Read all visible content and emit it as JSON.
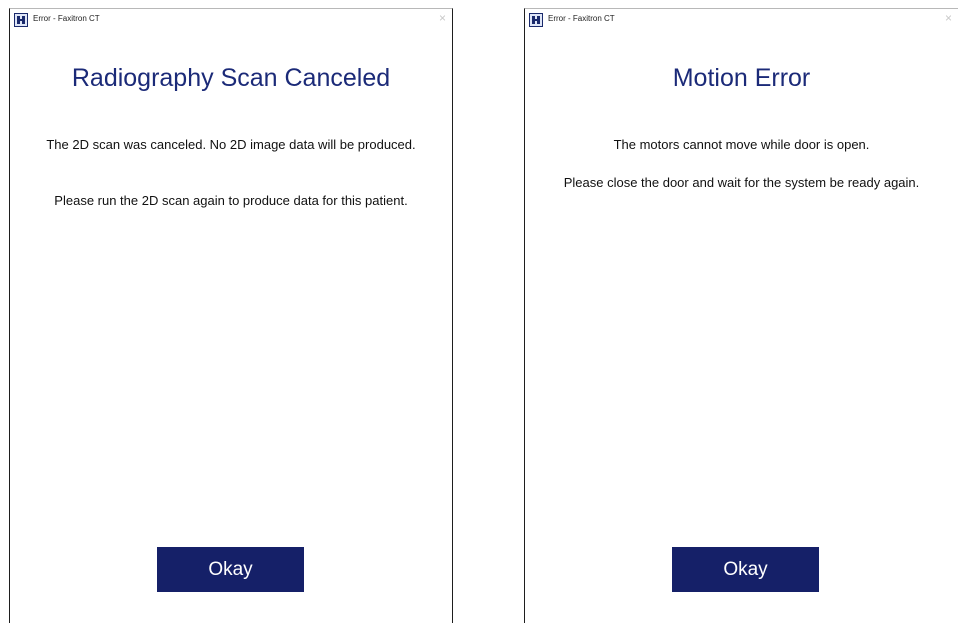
{
  "dialogs": [
    {
      "window_title": "Error - Faxitron CT",
      "close_glyph": "×",
      "heading": "Radiography Scan Canceled",
      "message_1": "The 2D scan was canceled. No 2D image data will be produced.",
      "message_2": "Please run the 2D scan again to produce data for this patient.",
      "button_label": "Okay"
    },
    {
      "window_title": "Error - Faxitron CT",
      "close_glyph": "×",
      "heading": "Motion Error",
      "message_1": "The motors cannot move while door is open.",
      "message_2": "Please close the door and wait for the system be ready again.",
      "button_label": "Okay"
    }
  ],
  "colors": {
    "heading": "#1b2a78",
    "button_bg": "#152068",
    "button_text": "#ffffff"
  },
  "icons": {
    "app": "faxitron-app-icon",
    "close": "close-icon"
  }
}
